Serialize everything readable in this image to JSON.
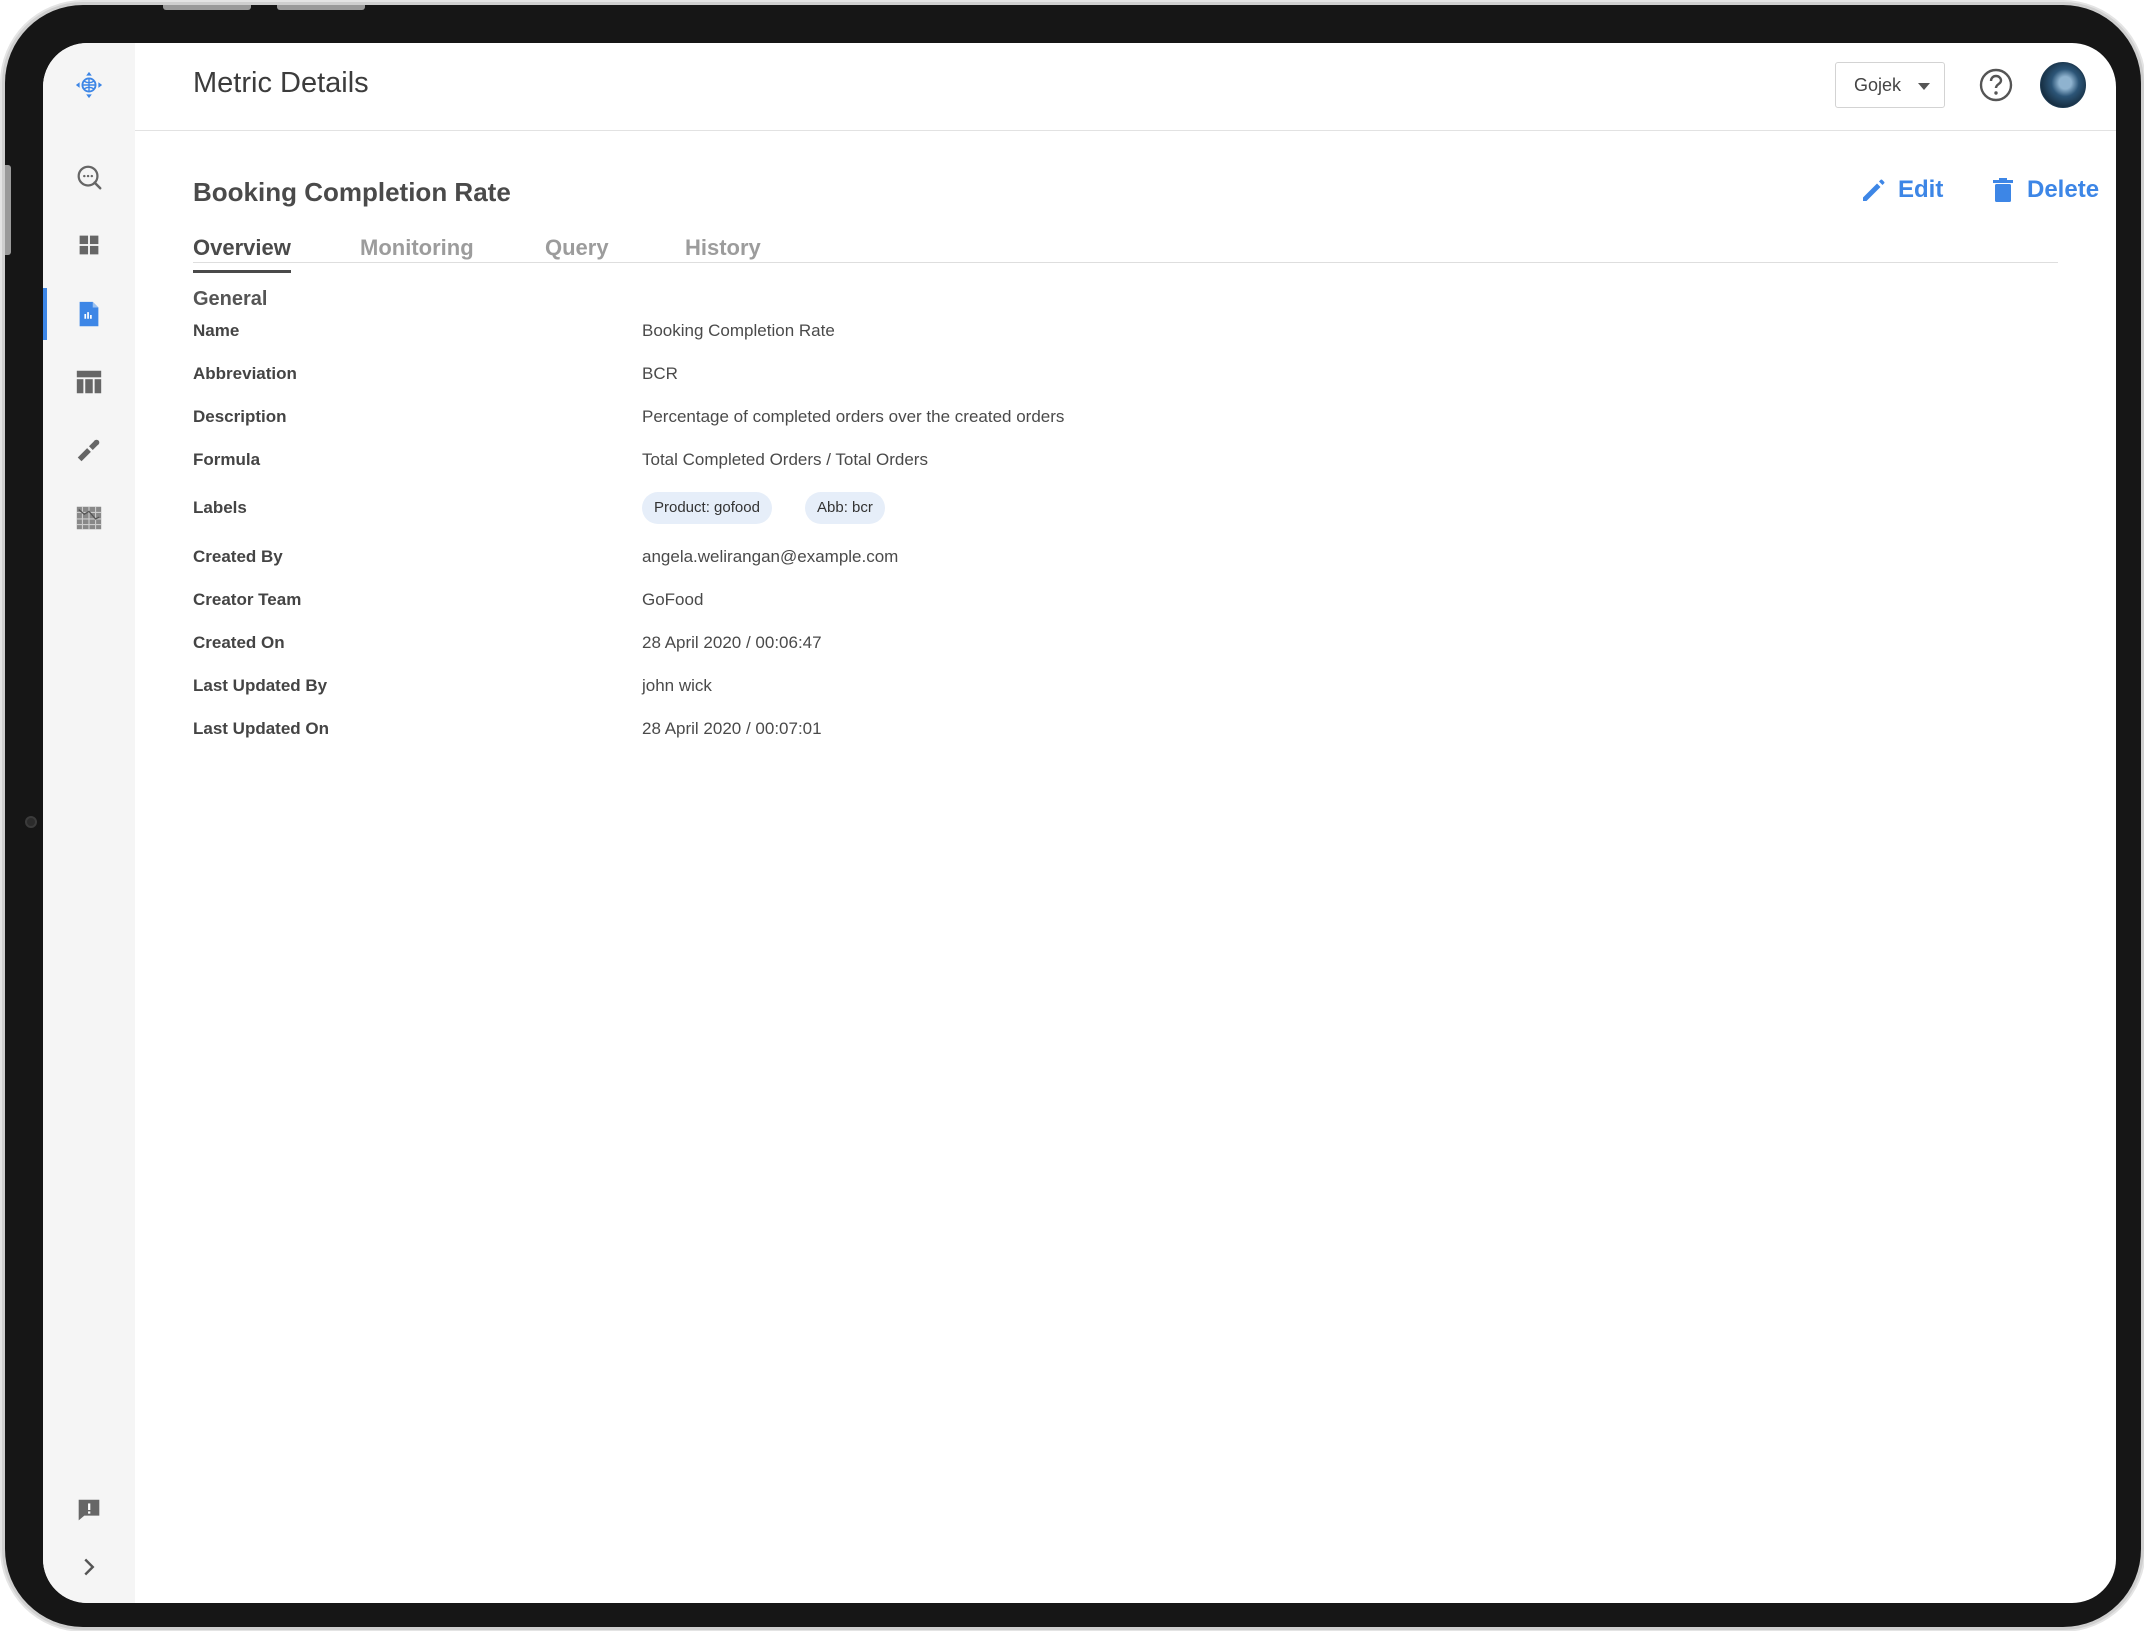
{
  "header": {
    "title": "Metric Details",
    "org_select": {
      "value": "Gojek"
    }
  },
  "sidebar": {
    "items": [
      {
        "icon": "logo-icon"
      },
      {
        "icon": "search-icon"
      },
      {
        "icon": "dashboard-icon"
      },
      {
        "icon": "metric-document-icon",
        "active": true
      },
      {
        "icon": "table-icon"
      },
      {
        "icon": "tools-icon"
      },
      {
        "icon": "map-icon"
      },
      {
        "icon": "feedback-icon"
      },
      {
        "icon": "chevron-right-icon"
      }
    ]
  },
  "detail": {
    "title": "Booking Completion Rate",
    "edit_label": "Edit",
    "delete_label": "Delete"
  },
  "tabs": [
    {
      "label": "Overview",
      "active": true
    },
    {
      "label": "Monitoring"
    },
    {
      "label": "Query"
    },
    {
      "label": "History"
    }
  ],
  "general": {
    "section_title": "General",
    "fields": [
      {
        "key": "Name",
        "value": "Booking Completion Rate"
      },
      {
        "key": "Abbreviation",
        "value": "BCR"
      },
      {
        "key": "Description",
        "value": "Percentage of completed orders over the created orders"
      },
      {
        "key": "Formula",
        "value": "Total Completed Orders / Total Orders"
      },
      {
        "key": "Labels",
        "chips": [
          "Product: gofood",
          "Abb: bcr"
        ]
      },
      {
        "key": "Created By",
        "value": "angela.welirangan@example.com"
      },
      {
        "key": "Creator Team",
        "value": "GoFood"
      },
      {
        "key": "Created On",
        "value": "28 April 2020 / 00:06:47"
      },
      {
        "key": "Last Updated By",
        "value": "john wick"
      },
      {
        "key": "Last Updated On",
        "value": "28 April 2020 / 00:07:01"
      }
    ]
  },
  "colors": {
    "accent": "#3d86e6",
    "sidebar_bg": "#f5f5f5",
    "chip_bg": "#e6eef9"
  }
}
